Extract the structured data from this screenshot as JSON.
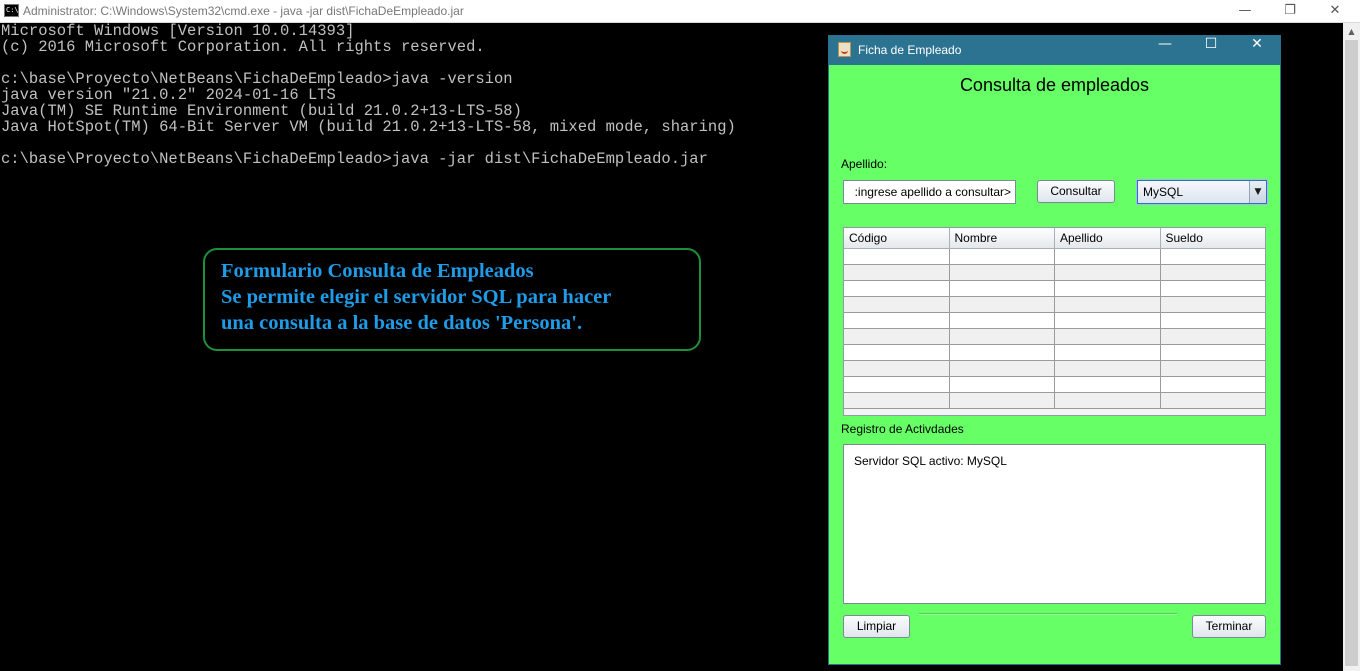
{
  "cmd": {
    "icon_text": "C:\\",
    "title": "Administrator: C:\\Windows\\System32\\cmd.exe - java  -jar dist\\FichaDeEmpleado.jar",
    "controls": {
      "minimize": "—",
      "maximize": "❐",
      "close": "✕"
    },
    "lines": [
      "Microsoft Windows [Version 10.0.14393]",
      "(c) 2016 Microsoft Corporation. All rights reserved.",
      "",
      "c:\\base\\Proyecto\\NetBeans\\FichaDeEmpleado>java -version",
      "java version \"21.0.2\" 2024-01-16 LTS",
      "Java(TM) SE Runtime Environment (build 21.0.2+13-LTS-58)",
      "Java HotSpot(TM) 64-Bit Server VM (build 21.0.2+13-LTS-58, mixed mode, sharing)",
      "",
      "c:\\base\\Proyecto\\NetBeans\\FichaDeEmpleado>java -jar dist\\FichaDeEmpleado.jar"
    ],
    "scroll_up_glyph": "▲"
  },
  "callout": {
    "line1": "Formulario Consulta de Empleados",
    "line2": "Se permite elegir el servidor SQL para hacer",
    "line3": "una consulta a la base de datos 'Persona'.",
    "color": "#1e9ce8"
  },
  "java_window": {
    "title": "Ficha de Empleado",
    "controls": {
      "minimize": "—",
      "maximize": "☐",
      "close": "✕"
    },
    "background": "#66ff66",
    "heading": "Consulta de empleados",
    "apellido_label": "Apellido:",
    "apellido_value": ":ingrese apellido a consultar>",
    "consultar_label": "Consultar",
    "server": {
      "selected": "MySQL",
      "arrow": "▼"
    },
    "table": {
      "columns": [
        "Código",
        "Nombre",
        "Apellido",
        "Sueldo"
      ],
      "rows": [
        [
          "",
          "",
          "",
          ""
        ],
        [
          "",
          "",
          "",
          ""
        ],
        [
          "",
          "",
          "",
          ""
        ],
        [
          "",
          "",
          "",
          ""
        ],
        [
          "",
          "",
          "",
          ""
        ],
        [
          "",
          "",
          "",
          ""
        ],
        [
          "",
          "",
          "",
          ""
        ],
        [
          "",
          "",
          "",
          ""
        ],
        [
          "",
          "",
          "",
          ""
        ],
        [
          "",
          "",
          "",
          ""
        ]
      ]
    },
    "log_label": "Registro de Activdades",
    "log_text": "Servidor SQL activo: MySQL",
    "limpiar_label": "Limpiar",
    "terminar_label": "Terminar"
  }
}
